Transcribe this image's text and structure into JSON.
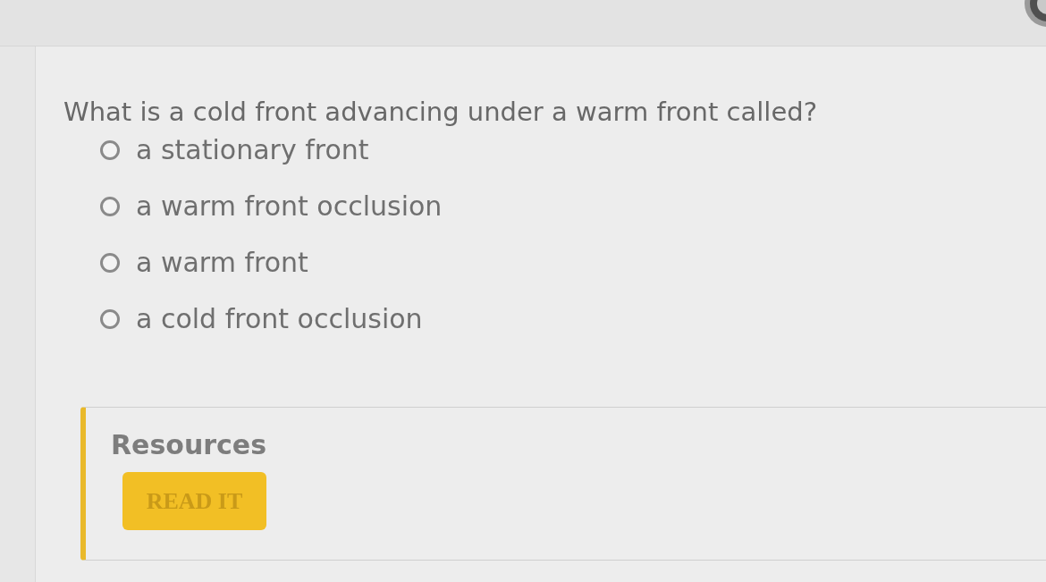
{
  "question": {
    "text": "What is a cold front advancing under a warm front called?",
    "options": [
      {
        "label": "a stationary front",
        "selected": false
      },
      {
        "label": "a warm front occlusion",
        "selected": false
      },
      {
        "label": "a warm front",
        "selected": false
      },
      {
        "label": "a cold front occlusion",
        "selected": false
      }
    ]
  },
  "resources": {
    "heading": "Resources",
    "buttons": [
      {
        "label": "READ IT"
      }
    ]
  }
}
